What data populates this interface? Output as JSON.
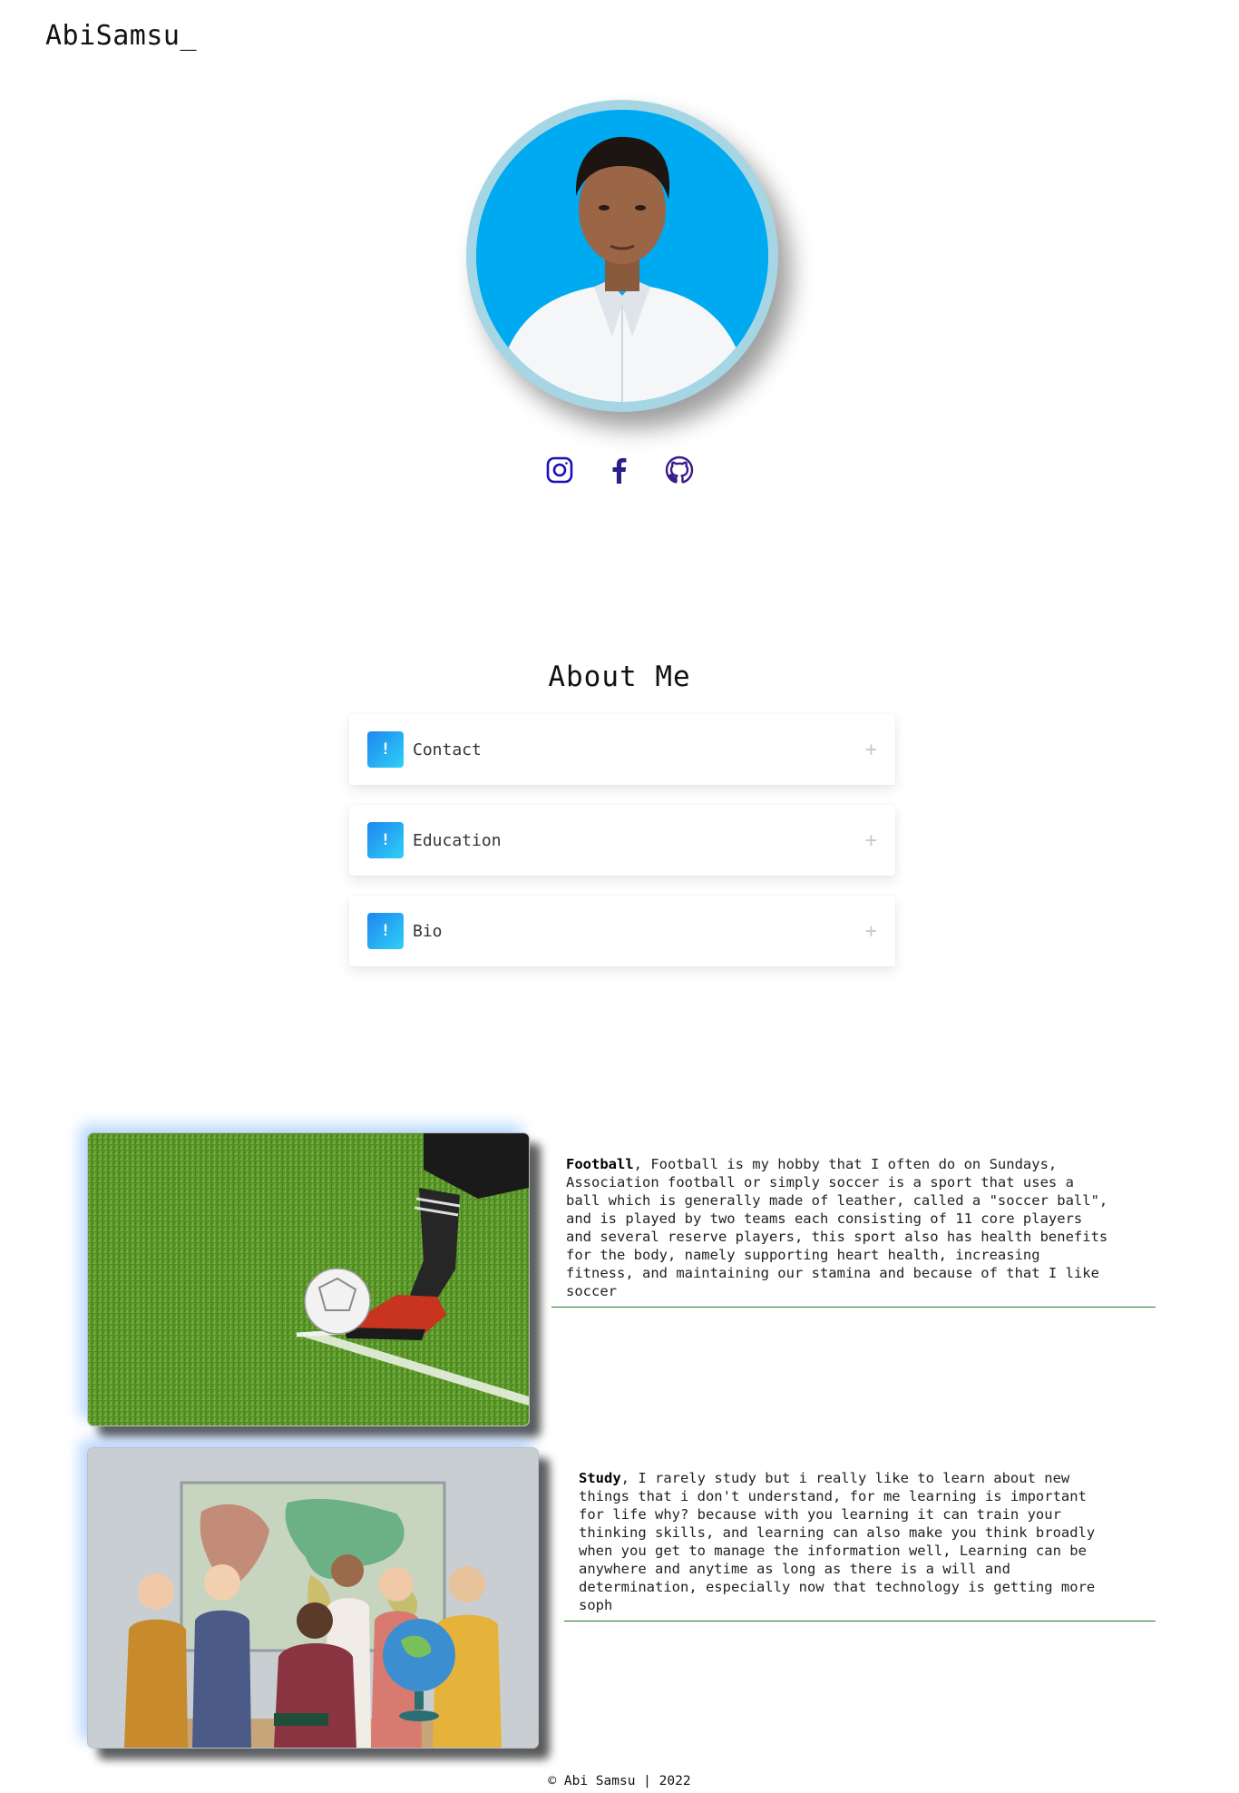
{
  "header": {
    "brand": "AbiSamsu_"
  },
  "profile": {
    "photo": "profile-photo"
  },
  "socials": [
    {
      "name": "instagram-icon",
      "color": "#1a0fb8"
    },
    {
      "name": "facebook-icon",
      "color": "#2a1f8a"
    },
    {
      "name": "github-icon",
      "color": "#3a1a8a"
    }
  ],
  "about": {
    "title": "About Me",
    "items": [
      {
        "badge": "!",
        "label": "Contact",
        "toggle": "+"
      },
      {
        "badge": "!",
        "label": "Education",
        "toggle": "+"
      },
      {
        "badge": "!",
        "label": "Bio",
        "toggle": "+"
      }
    ]
  },
  "hobbies": [
    {
      "title": "Football",
      "text": ", Football is my hobby that I often do on Sundays,\nAssociation football or simply soccer is a sport that uses a\nball which is generally made of leather, called a \"soccer ball\",\nand is played by two teams each consisting of 11 core players\nand several reserve players, this sport also has health benefits\nfor the body, namely supporting heart health, increasing\nfitness, and maintaining our stamina and because of that I like\nsoccer",
      "image": "football-photo"
    },
    {
      "title": "Study",
      "text": ", I rarely study but i really like to learn about new\nthings that i don't understand, for me learning is important\nfor life why? because with you learning it can train your\nthinking skills, and learning can also make you think broadly\nwhen you get to manage the information well, Learning can be\nanywhere and anytime as long as there is a will and\ndetermination, especially now that technology is getting more\nsoph",
      "image": "classroom-photo"
    }
  ],
  "footer": {
    "text": "© Abi Samsu | 2022"
  },
  "colors": {
    "accent": "#1e86f0",
    "avatar_bg": "#00aaf1",
    "divider": "#1e7a1e"
  }
}
